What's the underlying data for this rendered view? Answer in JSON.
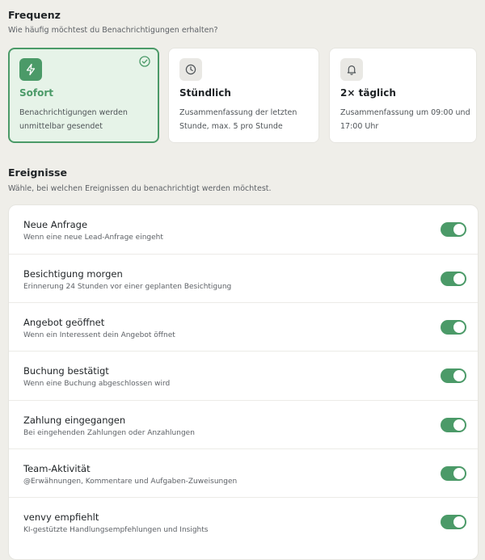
{
  "frequency": {
    "title": "Frequenz",
    "subtitle": "Wie häufig möchtest du Benachrichtigungen erhalten?",
    "selected_index": 0,
    "options": [
      {
        "title": "Sofort",
        "description": "Benachrichtigungen werden unmittelbar gesendet",
        "icon": "lightning-icon",
        "selected": true
      },
      {
        "title": "Stündlich",
        "description": "Zusammenfassung der letzten Stunde, max. 5 pro Stunde",
        "icon": "clock-icon",
        "selected": false
      },
      {
        "title": "2× täglich",
        "description": "Zusammenfassung um 09:00 und 17:00 Uhr",
        "icon": "bell-icon",
        "selected": false
      }
    ]
  },
  "events": {
    "title": "Ereignisse",
    "subtitle": "Wähle, bei welchen Ereignissen du benachrichtigt werden möchtest.",
    "items": [
      {
        "name": "Neue Anfrage",
        "description": "Wenn eine neue Lead-Anfrage eingeht",
        "enabled": true
      },
      {
        "name": "Besichtigung morgen",
        "description": "Erinnerung 24 Stunden vor einer geplanten Besichtigung",
        "enabled": true
      },
      {
        "name": "Angebot geöffnet",
        "description": "Wenn ein Interessent dein Angebot öffnet",
        "enabled": true
      },
      {
        "name": "Buchung bestätigt",
        "description": "Wenn eine Buchung abgeschlossen wird",
        "enabled": true
      },
      {
        "name": "Zahlung eingegangen",
        "description": "Bei eingehenden Zahlungen oder Anzahlungen",
        "enabled": true
      },
      {
        "name": "Team-Aktivität",
        "description": "@Erwähnungen, Kommentare und Aufgaben-Zuweisungen",
        "enabled": true
      },
      {
        "name": "venvy empfiehlt",
        "description": "KI-gestützte Handlungsempfehlungen und Insights",
        "enabled": true
      }
    ]
  },
  "colors": {
    "accent": "#4b9a68",
    "selected_bg": "#e6f3e8",
    "page_bg": "#efeee9"
  }
}
